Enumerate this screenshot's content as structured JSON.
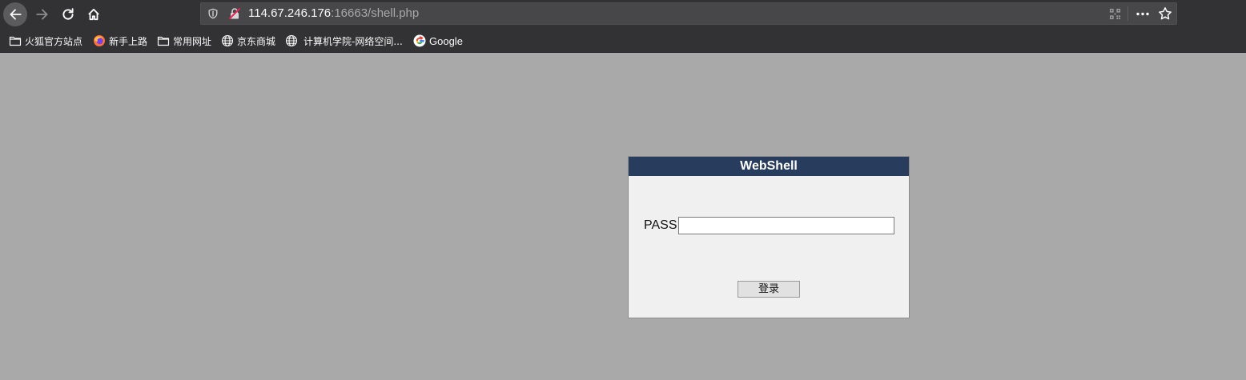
{
  "browser": {
    "url_host": "114.67.246.176",
    "url_rest": ":16663/shell.php",
    "bookmarks": [
      {
        "label": "火狐官方站点",
        "icon": "folder-icon"
      },
      {
        "label": "新手上路",
        "icon": "firefox-icon"
      },
      {
        "label": "常用网址",
        "icon": "folder-icon"
      },
      {
        "label": "京东商城",
        "icon": "globe-icon"
      },
      {
        "label": "计算机学院-网络空间...",
        "icon": "globe-icon"
      },
      {
        "label": "Google",
        "icon": "google-icon"
      }
    ]
  },
  "login": {
    "title": "WebShell",
    "pass_label": "PASS:",
    "pass_value": "",
    "submit_label": "登录"
  },
  "colors": {
    "page_background": "#a9a9a9",
    "header_background": "#283c5e",
    "panel_background": "#f0f0f0",
    "browser_chrome": "#323234"
  }
}
